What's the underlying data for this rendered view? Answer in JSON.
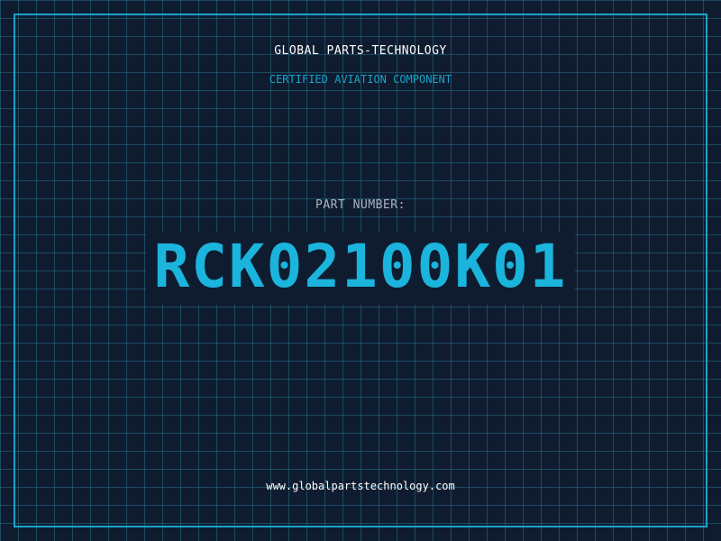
{
  "header": {
    "company": "GLOBAL PARTS-TECHNOLOGY",
    "tagline": "CERTIFIED AVIATION COMPONENT"
  },
  "part": {
    "label": "PART NUMBER:",
    "number": "RCK02100K01"
  },
  "footer": {
    "website": "www.globalpartstechnology.com"
  },
  "colors": {
    "background": "#0f1c30",
    "grid": "#28829b",
    "accent": "#1aa3c9",
    "part_number": "#1ab4dc",
    "text": "#ffffff",
    "muted_text": "#aab4c2"
  }
}
